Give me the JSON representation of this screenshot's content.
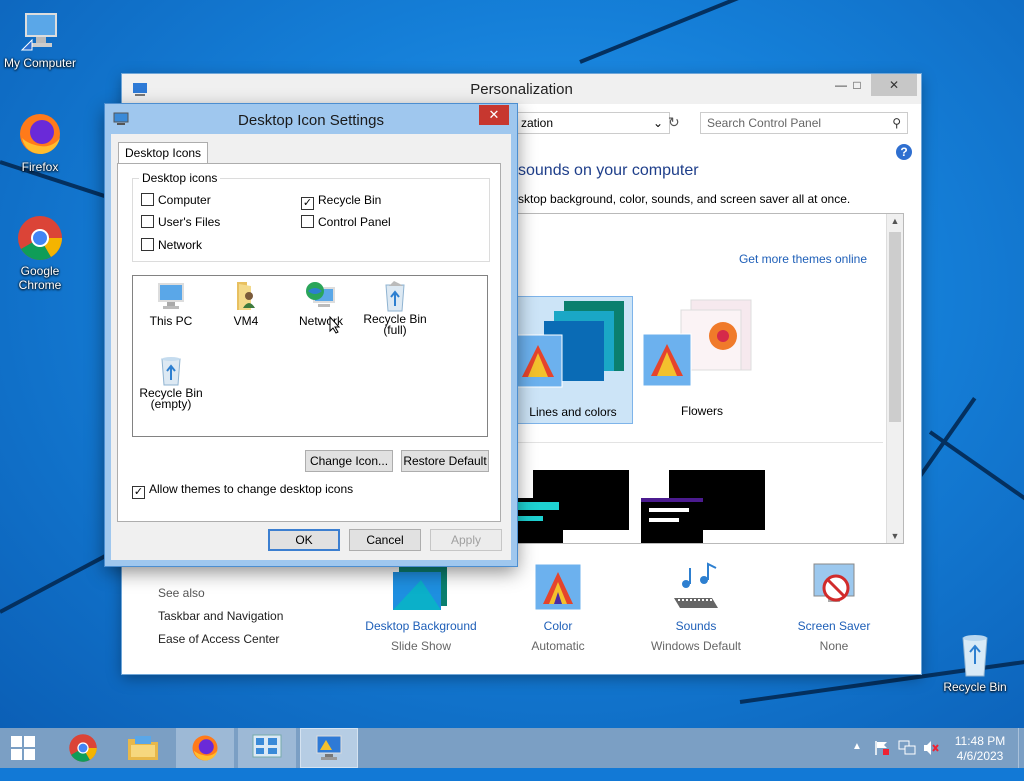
{
  "desktop": {
    "icons": [
      {
        "label": "My Computer"
      },
      {
        "label": "Firefox"
      },
      {
        "label": "Google Chrome"
      },
      {
        "label": "Recycle Bin"
      }
    ]
  },
  "personalization": {
    "title": "Personalization",
    "address_fragment": "zation",
    "search_placeholder": "Search Control Panel",
    "heading_fragment": "sounds on your computer",
    "subtitle_fragment": "sktop background, color, sounds, and screen saver all at once.",
    "get_more_themes": "Get more themes online",
    "themes": [
      {
        "name": "Lines and colors",
        "selected": true
      },
      {
        "name": "Flowers",
        "selected": false
      }
    ],
    "see_also": {
      "header": "See also",
      "links": [
        "Taskbar and Navigation",
        "Ease of Access Center"
      ]
    },
    "tiles": [
      {
        "name": "Desktop Background",
        "value": "Slide Show"
      },
      {
        "name": "Color",
        "value": "Automatic"
      },
      {
        "name": "Sounds",
        "value": "Windows Default"
      },
      {
        "name": "Screen Saver",
        "value": "None"
      }
    ]
  },
  "dialog": {
    "title": "Desktop Icon Settings",
    "tab": "Desktop Icons",
    "group_label": "Desktop icons",
    "checkboxes": [
      {
        "label": "Computer",
        "checked": false
      },
      {
        "label": "Recycle Bin",
        "checked": true
      },
      {
        "label": "User's Files",
        "checked": false
      },
      {
        "label": "Control Panel",
        "checked": false
      },
      {
        "label": "Network",
        "checked": false
      }
    ],
    "icon_list": [
      {
        "label": "This PC"
      },
      {
        "label": "VM4"
      },
      {
        "label": "Network"
      },
      {
        "label": "Recycle Bin\n(full)"
      },
      {
        "label": "Recycle Bin\n(empty)"
      }
    ],
    "change_icon": "Change Icon...",
    "restore_default": "Restore Default",
    "allow_themes": "Allow themes to change desktop icons",
    "allow_themes_checked": true,
    "ok": "OK",
    "cancel": "Cancel",
    "apply": "Apply"
  },
  "taskbar": {
    "time": "11:48 PM",
    "date": "4/6/2023"
  },
  "colors": {
    "accent": "#1e5fb8",
    "desktop": "#157fd8",
    "taskbar": "#7b9fc4",
    "dialog_frame": "#9fc7ee",
    "close_red": "#c7372f"
  }
}
